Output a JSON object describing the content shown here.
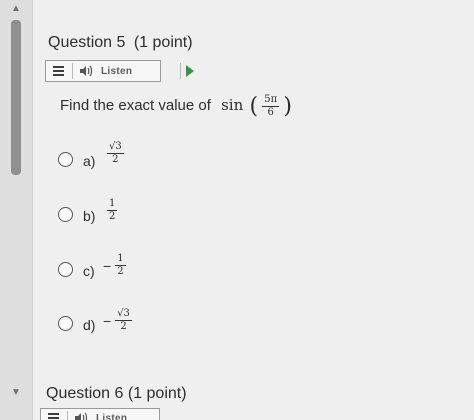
{
  "scrollbar": {
    "up_glyph": "▲",
    "down_glyph": "▼"
  },
  "question5": {
    "title": "Question 5",
    "points": "(1 point)",
    "listen_label": "Listen",
    "prompt": "Find the exact value of",
    "function_name": "sin",
    "argument": {
      "numerator": "5π",
      "denominator": "6"
    },
    "options": [
      {
        "letter": "a)",
        "sign": "",
        "numerator": "√3",
        "denominator": "2"
      },
      {
        "letter": "b)",
        "sign": "",
        "numerator": "1",
        "denominator": "2"
      },
      {
        "letter": "c)",
        "sign": "−",
        "numerator": "1",
        "denominator": "2"
      },
      {
        "letter": "d)",
        "sign": "−",
        "numerator": "√3",
        "denominator": "2"
      }
    ]
  },
  "question6": {
    "title": "Question 6",
    "points": "(1 point)",
    "listen_label": "Listen"
  },
  "icons": {
    "menu": "menu-icon",
    "speaker": "speaker-icon",
    "play": "play-icon",
    "radio": "radio-button"
  },
  "colors": {
    "background": "#efefef",
    "text": "#2d2d2d",
    "play_green": "#2d9a42",
    "border": "#9a9a9a"
  }
}
